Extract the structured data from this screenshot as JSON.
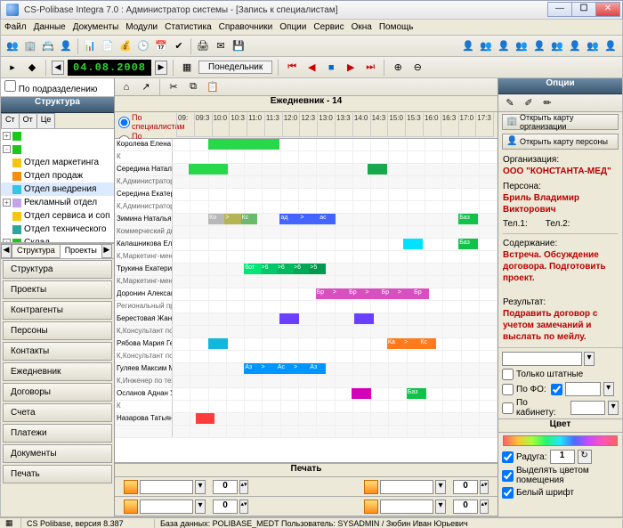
{
  "window": {
    "title": "CS-Polibase Integra 7.0 : Администратор системы - [Запись к специалистам]"
  },
  "menu": [
    "Файл",
    "Данные",
    "Документы",
    "Модули",
    "Статистика",
    "Справочники",
    "Опции",
    "Сервис",
    "Окна",
    "Помощь"
  ],
  "datebar": {
    "date": "04.08.2008",
    "day": "Понедельник"
  },
  "left": {
    "chk_label": "По подразделению",
    "caption": "Структура",
    "tabs": [
      "Ст",
      "От",
      "Це"
    ],
    "tree": [
      {
        "tgl": "+",
        "ic": "green",
        "label": ""
      },
      {
        "tgl": "-",
        "ic": "green",
        "label": ""
      },
      {
        "ic": "yellow",
        "label": "Отдел маркетинга"
      },
      {
        "ic": "orange",
        "label": "Отдел продаж"
      },
      {
        "ic": "cyan",
        "label": "Отдел внедрения",
        "sel": true
      },
      {
        "tgl": "+",
        "ic": "lav",
        "label": "Рекламный отдел"
      },
      {
        "ic": "yellow",
        "label": "Отдел сервиса и соп"
      },
      {
        "ic": "teal",
        "label": "Отдел технического"
      },
      {
        "tgl": "+",
        "ic": "green",
        "label": "Склад"
      }
    ],
    "mid_tabs": {
      "items": [
        "Структура",
        "Проекты"
      ],
      "active": 1
    },
    "nav": [
      "Структура",
      "Проекты",
      "Контрагенты",
      "Персоны",
      "Контакты",
      "Ежедневник",
      "Договоры",
      "Счета",
      "Платежи",
      "Документы",
      "Печать"
    ]
  },
  "center": {
    "caption": "Ежедневник - 14",
    "radio1": "По специалистам",
    "radio2": "По помещениям",
    "hours": [
      "09:",
      "09:3",
      "10:0",
      "10:3",
      "11:0",
      "11:3",
      "12:0",
      "12:3",
      "13:0",
      "13:3",
      "14:0",
      "14:3",
      "15:0",
      "15:3",
      "16:0",
      "16:3",
      "17:0",
      "17:3"
    ],
    "rows": [
      {
        "name": "Королева Елена Влади",
        "role": "К",
        "blocks": [
          {
            "l": 11,
            "w": 22,
            "c": "#27d84b"
          }
        ]
      },
      {
        "name": "Середина Наталья Але",
        "role": "К,Администратор",
        "blocks": [
          {
            "l": 5,
            "w": 12,
            "c": "#27d84b"
          },
          {
            "l": 60,
            "w": 6,
            "c": "#1aa84f"
          }
        ]
      },
      {
        "name": "Середина Екатерина Але",
        "role": "К,Администратор",
        "blocks": []
      },
      {
        "name": "Зимина Наталья Геннад",
        "role": "Коммерческий директор",
        "blocks": [
          {
            "l": 11,
            "w": 5,
            "c": "#b8b8b8",
            "t": "Ко"
          },
          {
            "l": 16,
            "w": 5,
            "c": "#b4b455",
            "t": ">"
          },
          {
            "l": 21,
            "w": 5,
            "c": "#6bb96b",
            "t": "Кс"
          },
          {
            "l": 33,
            "w": 6,
            "c": "#4464ff",
            "t": "ад"
          },
          {
            "l": 39,
            "w": 6,
            "c": "#4464ff",
            "t": ">"
          },
          {
            "l": 45,
            "w": 5,
            "c": "#4464ff",
            "t": "ас"
          },
          {
            "l": 88,
            "w": 6,
            "c": "#10c249",
            "t": "Баз"
          }
        ]
      },
      {
        "name": "Калашникова Елена Ник",
        "role": "К,Маркетинг-менеджер",
        "blocks": [
          {
            "l": 71,
            "w": 6,
            "c": "#00e2ff"
          },
          {
            "l": 88,
            "w": 6,
            "c": "#10c249",
            "t": "Баз"
          }
        ]
      },
      {
        "name": "Трукина Екатерина Викт",
        "role": "К,Маркетинг-менеджер",
        "blocks": [
          {
            "l": 22,
            "w": 5,
            "c": "#00e676",
            "t": "бот"
          },
          {
            "l": 27,
            "w": 5,
            "c": "#00c767",
            "t": ">6"
          },
          {
            "l": 32,
            "w": 5,
            "c": "#00b85e",
            "t": ">6"
          },
          {
            "l": 37,
            "w": 5,
            "c": "#00a956",
            "t": ">6"
          },
          {
            "l": 42,
            "w": 5,
            "c": "#009a4e",
            "t": ">5"
          }
        ]
      },
      {
        "name": "Доронин Александр Бор",
        "role": "Региональный представ",
        "blocks": [
          {
            "l": 44,
            "w": 5,
            "c": "#d84fbf",
            "t": "Бр"
          },
          {
            "l": 49,
            "w": 5,
            "c": "#d84fbf",
            "t": ">"
          },
          {
            "l": 54,
            "w": 5,
            "c": "#d84fbf",
            "t": "Бр"
          },
          {
            "l": 59,
            "w": 5,
            "c": "#d84fbf",
            "t": ">"
          },
          {
            "l": 64,
            "w": 5,
            "c": "#d84fbf",
            "t": "Бр"
          },
          {
            "l": 69,
            "w": 5,
            "c": "#d84fbf",
            "t": ">"
          },
          {
            "l": 74,
            "w": 5,
            "c": "#d84fbf",
            "t": "Бр"
          }
        ]
      },
      {
        "name": "Берестовая Жанна Вале",
        "role": "К,Консультант по продаж",
        "blocks": [
          {
            "l": 33,
            "w": 6,
            "c": "#6a3fff"
          },
          {
            "l": 56,
            "w": 6,
            "c": "#6a3fff"
          }
        ]
      },
      {
        "name": "Рябова Мария Геннадь",
        "role": "К,Консультант по продаж",
        "blocks": [
          {
            "l": 11,
            "w": 6,
            "c": "#12b8dc"
          },
          {
            "l": 66,
            "w": 5,
            "c": "#ff7a1a",
            "t": "Ка"
          },
          {
            "l": 71,
            "w": 5,
            "c": "#ff7a1a",
            "t": ">"
          },
          {
            "l": 76,
            "w": 5,
            "c": "#ff7a1a",
            "t": "Кс"
          }
        ]
      },
      {
        "name": "Гуляев Максим Михайл",
        "role": "К,Инженер по техническ",
        "blocks": [
          {
            "l": 22,
            "w": 5,
            "c": "#0096ff",
            "t": "Аз"
          },
          {
            "l": 27,
            "w": 5,
            "c": "#0096ff",
            "t": ">"
          },
          {
            "l": 32,
            "w": 5,
            "c": "#0096ff",
            "t": "Ас"
          },
          {
            "l": 37,
            "w": 5,
            "c": "#0096ff",
            "t": ">"
          },
          {
            "l": 42,
            "w": 5,
            "c": "#0096ff",
            "t": "Аз"
          }
        ]
      },
      {
        "name": "Осланов Аднан Усманов",
        "role": "К",
        "blocks": [
          {
            "l": 55,
            "w": 6,
            "c": "#d400b8"
          },
          {
            "l": 72,
            "w": 6,
            "c": "#10c249",
            "t": "Баз"
          }
        ]
      },
      {
        "name": "Назарова Татьяна Алекс",
        "role": "",
        "blocks": [
          {
            "l": 7,
            "w": 6,
            "c": "#ff3b3b"
          }
        ]
      }
    ],
    "print_caption": "Печать",
    "print_spin": "0"
  },
  "right": {
    "caption": "Опции",
    "btn1": "Открыть карту организации",
    "btn2": "Открыть карту персоны",
    "org_lbl": "Организация:",
    "org_val": "ООО \"КОНСТАНТА-МЕД\"",
    "pers_lbl": "Персона:",
    "pers_val": "Бриль Владимир Викторович",
    "tel1": "Тел.1:",
    "tel2": "Тел.2:",
    "cont_lbl": "Содержание:",
    "cont_val": "Встреча. Обсуждение договора. Подготовить проект.",
    "res_lbl": "Результат:",
    "res_val": "Подравить договор с учетом замечаний и выслать по мейлу.",
    "chk_staff": "Только штатные",
    "chk_fio": "По ФО:",
    "chk_cab": "По кабинету:",
    "color_caption": "Цвет",
    "chk_rainbow": "Радуга:",
    "rainbow_num": "1",
    "chk_room_color": "Выделять цветом помещения",
    "chk_white_font": "Белый шрифт"
  },
  "status": {
    "version": "CS Polibase, версия 8.387",
    "db": "База данных: POLIBASE_MEDT Пользователь: SYSADMIN / Зюбин Иван Юрьевич"
  }
}
